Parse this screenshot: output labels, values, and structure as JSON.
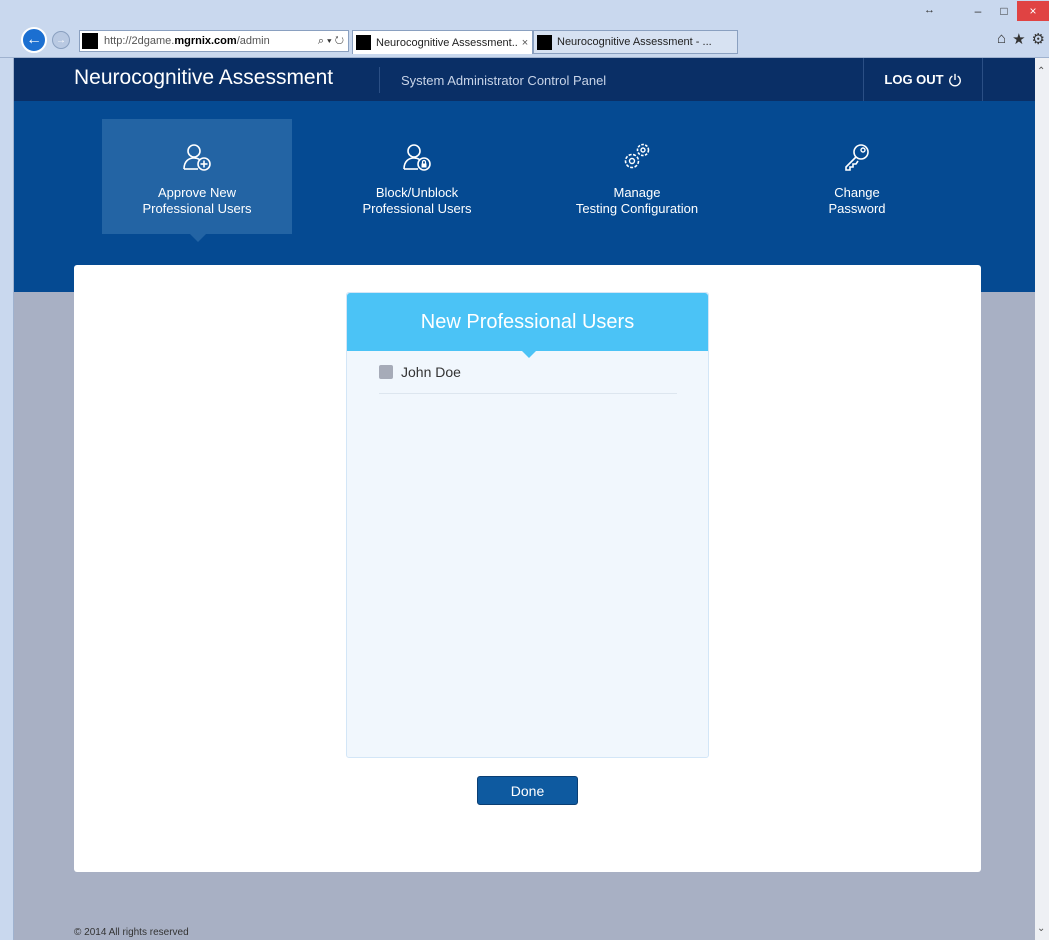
{
  "browser": {
    "address_url_prefix": "http://2dgame.",
    "address_url_domain": "mgrnix.com",
    "address_url_path": "/admin",
    "address_tools": "⌕ ▾ ↻",
    "tabs": [
      {
        "title": "Neurocognitive Assessment..."
      },
      {
        "title": "Neurocognitive Assessment - ..."
      }
    ],
    "tab_close": "×",
    "window_controls": {
      "minimize": "–",
      "maximize": "□",
      "close": "×"
    },
    "resize": "↔",
    "chrome_icons": [
      "home-icon",
      "star-icon",
      "gear-icon"
    ],
    "chrome_glyphs": {
      "home": "⌂",
      "star": "★",
      "gear": "⚙"
    }
  },
  "header": {
    "title": "Neurocognitive Assessment",
    "subtitle": "System Administrator Control Panel",
    "logout_label": "LOG OUT"
  },
  "nav": {
    "items": [
      {
        "line1": "Approve New",
        "line2": "Professional Users",
        "icon": "user-add-icon",
        "active": true
      },
      {
        "line1": "Block/Unblock",
        "line2": "Professional Users",
        "icon": "user-lock-icon",
        "active": false
      },
      {
        "line1": "Manage",
        "line2": "Testing Configuration",
        "icon": "gears-icon",
        "active": false
      },
      {
        "line1": "Change",
        "line2": "Password",
        "icon": "key-icon",
        "active": false
      }
    ]
  },
  "panel": {
    "title": "New Professional Users",
    "users": [
      {
        "name": "John Doe",
        "checked": false
      }
    ]
  },
  "actions": {
    "done_label": "Done"
  },
  "footer": {
    "copyright": "© 2014 All rights reserved"
  },
  "colors": {
    "header_bg": "#0a2f66",
    "nav_bg": "#054a92",
    "nav_active": "#2364a4",
    "panel_header": "#4bc3f6",
    "button": "#0e5aa0",
    "page_bg": "#a8b0c4"
  }
}
